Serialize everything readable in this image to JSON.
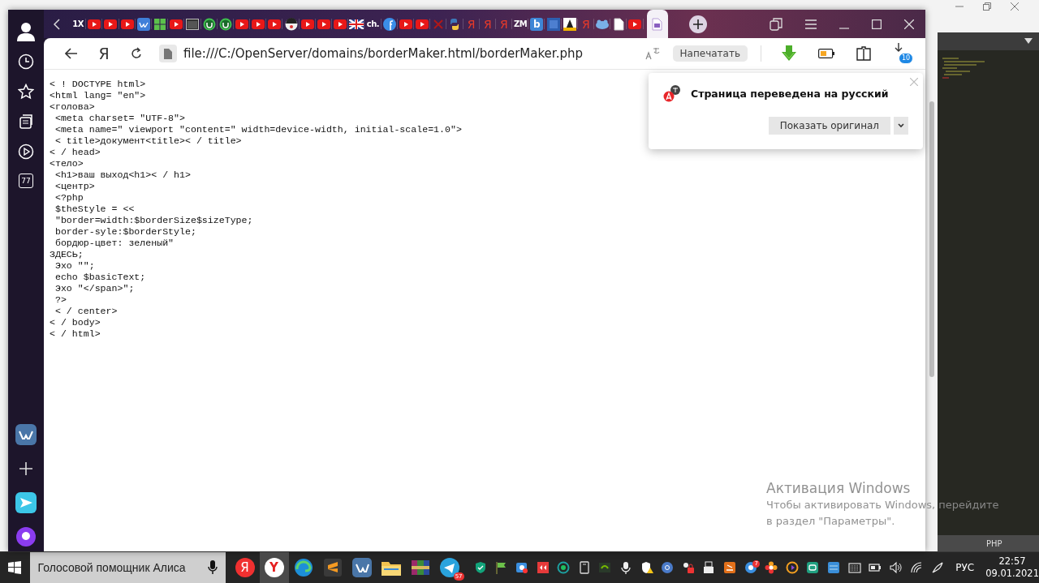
{
  "background_window": {
    "status_bar": {
      "language": "PHP"
    }
  },
  "browser": {
    "sidebar": {
      "top": [
        {
          "kind": "profile"
        },
        {
          "kind": "history"
        },
        {
          "kind": "bookmarks"
        },
        {
          "kind": "collections"
        },
        {
          "kind": "media"
        },
        {
          "kind": "counter",
          "label": "77"
        }
      ],
      "bottom": [
        {
          "kind": "vk"
        },
        {
          "kind": "add"
        },
        {
          "kind": "send"
        },
        {
          "kind": "assistant"
        }
      ]
    },
    "tabs": [
      {
        "kind": "text",
        "label": "1X",
        "selected": false
      },
      {
        "kind": "youtube",
        "selected": false
      },
      {
        "kind": "youtube",
        "selected": false
      },
      {
        "kind": "youtube",
        "selected": false
      },
      {
        "kind": "vk",
        "selected": false
      },
      {
        "kind": "windows",
        "selected": false
      },
      {
        "kind": "youtube",
        "selected": false
      },
      {
        "kind": "terminal",
        "selected": false
      },
      {
        "kind": "torrent",
        "selected": false
      },
      {
        "kind": "torrent",
        "selected": false
      },
      {
        "kind": "youtube",
        "selected": false
      },
      {
        "kind": "youtube",
        "selected": false
      },
      {
        "kind": "youtube",
        "selected": false
      },
      {
        "kind": "mascot",
        "selected": false
      },
      {
        "kind": "youtube",
        "selected": false
      },
      {
        "kind": "youtube",
        "selected": false
      },
      {
        "kind": "youtube",
        "selected": false
      },
      {
        "kind": "flag",
        "selected": false
      },
      {
        "kind": "text",
        "label": "ch.",
        "selected": false
      },
      {
        "kind": "facebook",
        "selected": false
      },
      {
        "kind": "youtube",
        "selected": false
      },
      {
        "kind": "youtube",
        "selected": false
      },
      {
        "kind": "cross",
        "selected": false
      },
      {
        "kind": "python",
        "selected": false
      },
      {
        "kind": "letter",
        "label": "Я",
        "selected": false
      },
      {
        "kind": "letter",
        "label": "Я",
        "selected": false
      },
      {
        "kind": "letter",
        "label": "Я",
        "selected": false
      },
      {
        "kind": "text",
        "label": "ZM",
        "selected": false
      },
      {
        "kind": "tile",
        "label": "b",
        "selected": false
      },
      {
        "kind": "square",
        "selected": false
      },
      {
        "kind": "dark-square",
        "selected": false
      },
      {
        "kind": "letter",
        "label": "Я",
        "selected": false
      },
      {
        "kind": "blob",
        "selected": false
      },
      {
        "kind": "document",
        "selected": false
      },
      {
        "kind": "youtube",
        "selected": false
      },
      {
        "kind": "page",
        "selected": true
      }
    ],
    "address_bar": {
      "logo": "Я",
      "url": "file:///C:/OpenServer/domains/borderMaker.html/borderMaker.php",
      "print_button": "Напечатать",
      "downloads_badge": "10"
    },
    "code_lines": [
      "< ! DOCTYPE html>",
      "<html lang= \"en\">",
      "<голова>",
      " <meta charset= \"UTF-8\">",
      " <meta name=\" viewport \"content=\" width=device-width, initial-scale=1.0\">",
      " < title>документ<title>< / title>",
      "< / head>",
      "<тело>",
      " <h1>ваш выход<h1>< / h1>",
      " <центр>",
      " <?php",
      " $theStyle = <<",
      " \"border=width:$borderSize$sizeType;",
      " border-syle:$borderStyle;",
      " бордюр-цвет: зеленый\"",
      "ЗДЕСЬ;",
      " Эхо \"\";",
      " echo $basicText;",
      " Эхо \"</span>\";",
      " ?>",
      " < / center>",
      "< / body>",
      "< / html>"
    ],
    "translate_popup": {
      "title": "Страница переведена на русский",
      "button": "Показать оригинал"
    }
  },
  "activation_notice": {
    "title": "Активация Windows",
    "text": "Чтобы активировать Windows, перейдите в раздел \"Параметры\"."
  },
  "taskbar": {
    "search": {
      "placeholder": "Голосовой помощник Алиса"
    },
    "apps": [
      {
        "kind": "letter-circle",
        "label": "Я",
        "active": false
      },
      {
        "kind": "letter-white",
        "label": "Y",
        "active": true
      },
      {
        "kind": "edge",
        "active": false
      },
      {
        "kind": "sublime",
        "active": false
      },
      {
        "kind": "vk",
        "active": false
      },
      {
        "kind": "folder",
        "active": false
      },
      {
        "kind": "archive",
        "active": false
      },
      {
        "kind": "telegram",
        "badge": "57",
        "active": false
      }
    ],
    "tray": [
      {
        "kind": "shield"
      },
      {
        "kind": "flag"
      },
      {
        "kind": "camera"
      },
      {
        "kind": "red-app"
      },
      {
        "kind": "ring"
      },
      {
        "kind": "phone"
      },
      {
        "kind": "board"
      },
      {
        "kind": "mic"
      },
      {
        "kind": "warning-shield"
      },
      {
        "kind": "bubble"
      },
      {
        "kind": "lock"
      },
      {
        "kind": "usb"
      },
      {
        "kind": "orange-app"
      },
      {
        "kind": "red-circle",
        "badge": "7"
      },
      {
        "kind": "flower"
      },
      {
        "kind": "color-ring"
      },
      {
        "kind": "teal-app"
      },
      {
        "kind": "blue-app"
      },
      {
        "kind": "keyboard"
      },
      {
        "kind": "battery"
      },
      {
        "kind": "volume"
      },
      {
        "kind": "wifi"
      },
      {
        "kind": "pen"
      }
    ],
    "language": "РУС",
    "time": "22:57",
    "date": "09.01.2021"
  }
}
